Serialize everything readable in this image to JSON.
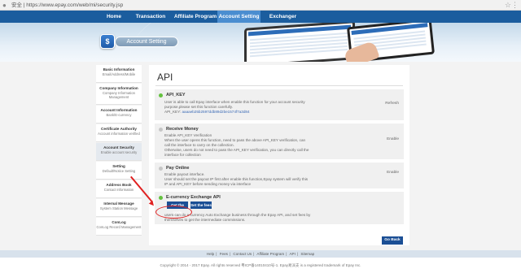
{
  "browser": {
    "url": "安全 | https://www.epay.com/web/mi/security.jsp",
    "lock_icon": "lock-icon"
  },
  "nav": {
    "items": [
      {
        "label": "Home"
      },
      {
        "label": "Transaction Record"
      },
      {
        "label": "Affiliate Program"
      },
      {
        "label": "Account Setting",
        "active": true
      },
      {
        "label": "Exchanger Rating"
      }
    ]
  },
  "banner": {
    "icon_glyph": "$",
    "title": "Account Setting"
  },
  "sidebar": {
    "items": [
      {
        "title": "Basic Information",
        "sub": "Email/Address/Mobile"
      },
      {
        "title": "Company Information",
        "sub": "Company Information Management"
      },
      {
        "title": "Account Information",
        "sub": "Bank/E-currency"
      },
      {
        "title": "Certificate Authority",
        "sub": "Account information verified"
      },
      {
        "title": "Account Security",
        "sub": "Enable account security",
        "active": true
      },
      {
        "title": "Setting",
        "sub": "Default/Notice Setting"
      },
      {
        "title": "Address Book",
        "sub": "Contact Information"
      },
      {
        "title": "Internal Message",
        "sub": "System Station Message"
      },
      {
        "title": "ConLog",
        "sub": "ConLog Record Management"
      }
    ]
  },
  "content": {
    "heading": "API",
    "panels": [
      {
        "title": "API_KEY",
        "desc1": "User is able to call Epay interface when enable this function for your account security",
        "desc2": "purpose,please set this function carefully.",
        "key_label": "API_KEY:",
        "key_value": "aaaaeb25b2597ddb89d2be1574f7a3d84",
        "action": "Refresh",
        "status": "green"
      },
      {
        "title": "Receive Money",
        "desc1": "Enable API_KEY Verification",
        "desc2": "When the user opens this function, need to pass the above API_KEY verification, can",
        "desc3": "call the interface to carry on the collection.",
        "desc4": "Otherwise, users do not need to pass the API_KEY verification, you can directly call the",
        "desc5": "interface for collection",
        "action": "Enable",
        "status": "grey"
      },
      {
        "title": "Pay Online",
        "desc1": "Enable payout interface.",
        "desc2": "User should set the payout IP first after enable this function,Epay system will verify this",
        "desc3": "IP and API_KEY before sending money via interface",
        "action": "Enable",
        "status": "grey"
      },
      {
        "title": "E-currency Exchange API",
        "btn_code": "Get the code",
        "btn_fees": "Set the fees",
        "desc1": "users can do e-currency Auto Exchange business through the Epay API, and set fees by",
        "desc2": "themselves to get the intermediate commissions.",
        "status": "green"
      }
    ],
    "goback": "Go Back"
  },
  "footer": {
    "links": [
      "Help",
      "Fees",
      "Contact Us",
      "Affiliate Program",
      "API",
      "Sitemap"
    ],
    "copyright": "Copyright © 2014 - 2017 Epay. All rights reserved 粤ICP备14010410号-1. Epay易派支 is a registered trademark of Epay Inc."
  }
}
